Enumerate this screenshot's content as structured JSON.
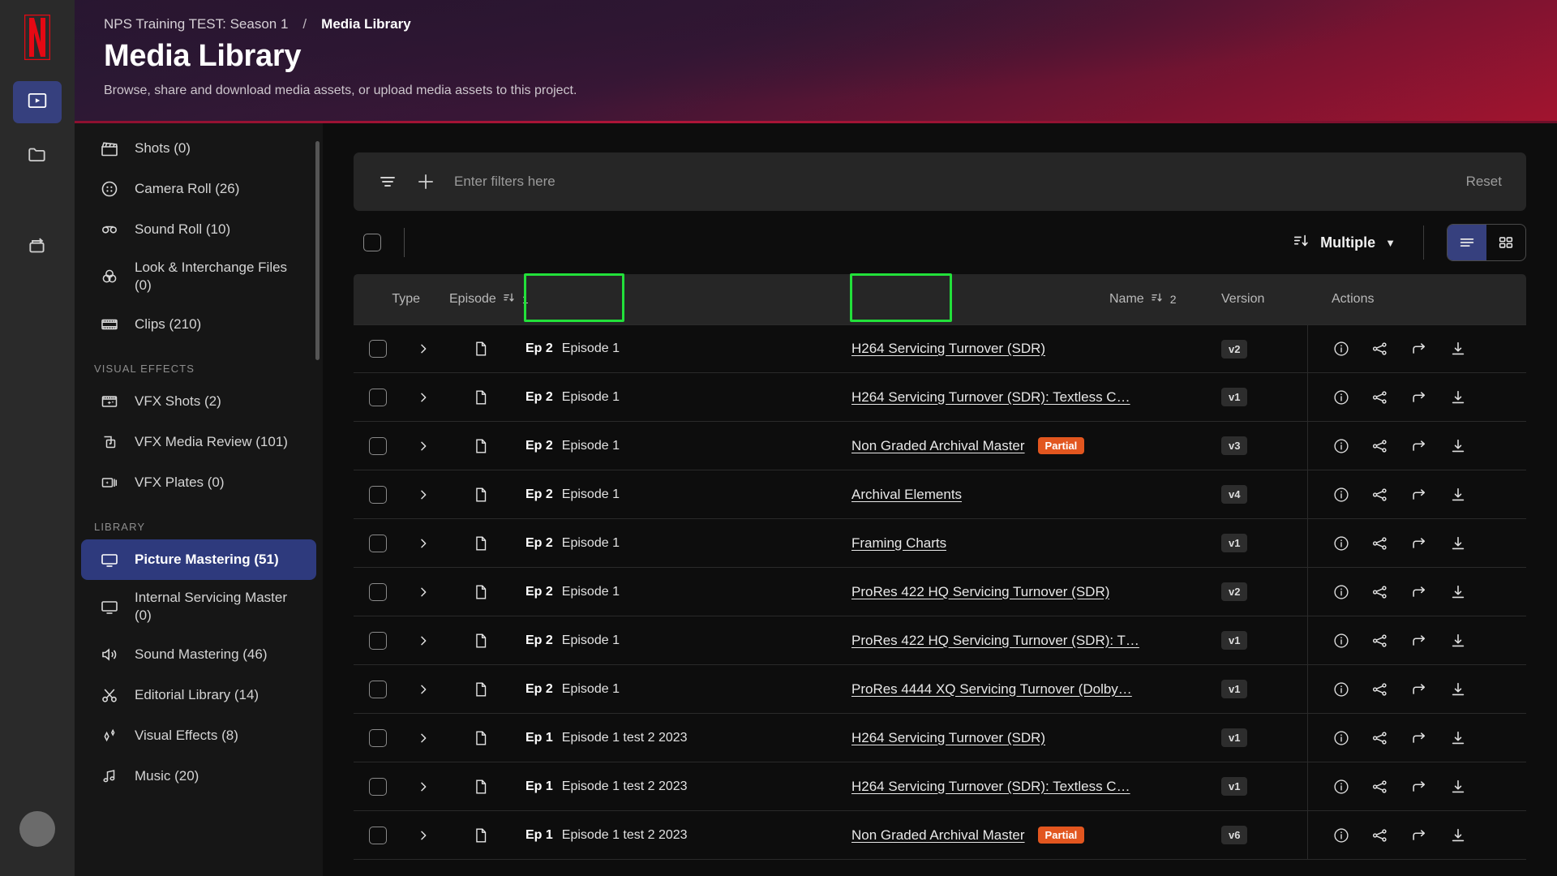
{
  "rail": {
    "logo": "netflix-n-logo",
    "buttons": [
      {
        "name": "media-player-icon",
        "active": true
      },
      {
        "name": "folder-icon",
        "active": false
      },
      {
        "name": "transfer-icon",
        "active": false
      }
    ],
    "avatar": "user-avatar"
  },
  "header": {
    "breadcrumb_project": "NPS Training TEST: Season 1",
    "breadcrumb_separator": "/",
    "breadcrumb_current": "Media Library",
    "title": "Media Library",
    "subtitle": "Browse, share and download media assets, or upload media assets to this project."
  },
  "sidebar": {
    "items": [
      {
        "label": "Shots (0)",
        "icon": "clapperboard-icon",
        "active": false
      },
      {
        "label": "Camera Roll (26)",
        "icon": "film-reel-icon",
        "active": false
      },
      {
        "label": "Sound Roll (10)",
        "icon": "sound-roll-icon",
        "active": false
      },
      {
        "label": "Look & Interchange Files (0)",
        "icon": "color-wheels-icon",
        "active": false
      },
      {
        "label": "Clips (210)",
        "icon": "filmstrip-icon",
        "active": false
      }
    ],
    "section_visual_effects": "VISUAL EFFECTS",
    "vfx_items": [
      {
        "label": "VFX Shots (2)",
        "icon": "vfx-shot-icon",
        "active": false
      },
      {
        "label": "VFX Media Review (101)",
        "icon": "vfx-review-icon",
        "active": false
      },
      {
        "label": "VFX Plates (0)",
        "icon": "vfx-plates-icon",
        "active": false
      }
    ],
    "section_library": "LIBRARY",
    "library_items": [
      {
        "label": "Picture Mastering (51)",
        "icon": "monitor-icon",
        "active": true
      },
      {
        "label": "Internal Servicing Master (0)",
        "icon": "monitor-icon",
        "active": false
      },
      {
        "label": "Sound Mastering (46)",
        "icon": "speaker-icon",
        "active": false
      },
      {
        "label": "Editorial Library (14)",
        "icon": "scissors-icon",
        "active": false
      },
      {
        "label": "Visual Effects (8)",
        "icon": "sparkle-icon",
        "active": false
      },
      {
        "label": "Music (20)",
        "icon": "music-note-icon",
        "active": false
      }
    ]
  },
  "filter_bar": {
    "filter_icon": "filter-icon",
    "add_icon": "plus-icon",
    "placeholder": "Enter filters here",
    "reset_label": "Reset"
  },
  "toolbar": {
    "select_all": "select-all-checkbox",
    "sort_label": "Multiple",
    "sort_icon": "sort-descending-icon",
    "caret_icon": "chevron-down-icon",
    "view_list": "list-view-icon",
    "view_grid": "grid-view-icon",
    "active_view": "list"
  },
  "table": {
    "columns": {
      "type": "Type",
      "episode": "Episode",
      "episode_sort_order": "1",
      "name": "Name",
      "name_sort_order": "2",
      "version": "Version",
      "actions": "Actions"
    },
    "action_icons": [
      "info-icon",
      "share-nodes-icon",
      "forward-arrow-icon",
      "download-icon"
    ],
    "rows": [
      {
        "episode_tag": "Ep 2",
        "episode_name": "Episode 1",
        "name": "H264 Servicing Turnover (SDR)",
        "badge": "",
        "version": "v2"
      },
      {
        "episode_tag": "Ep 2",
        "episode_name": "Episode 1",
        "name": "H264 Servicing Turnover (SDR): Textless C…",
        "badge": "",
        "version": "v1"
      },
      {
        "episode_tag": "Ep 2",
        "episode_name": "Episode 1",
        "name": "Non Graded Archival Master",
        "badge": "Partial",
        "version": "v3"
      },
      {
        "episode_tag": "Ep 2",
        "episode_name": "Episode 1",
        "name": "Archival Elements",
        "badge": "",
        "version": "v4"
      },
      {
        "episode_tag": "Ep 2",
        "episode_name": "Episode 1",
        "name": "Framing Charts",
        "badge": "",
        "version": "v1"
      },
      {
        "episode_tag": "Ep 2",
        "episode_name": "Episode 1",
        "name": "ProRes 422 HQ Servicing Turnover (SDR)",
        "badge": "",
        "version": "v2"
      },
      {
        "episode_tag": "Ep 2",
        "episode_name": "Episode 1",
        "name": "ProRes 422 HQ Servicing Turnover (SDR): T…",
        "badge": "",
        "version": "v1"
      },
      {
        "episode_tag": "Ep 2",
        "episode_name": "Episode 1",
        "name": "ProRes 4444 XQ Servicing Turnover (Dolby…",
        "badge": "",
        "version": "v1"
      },
      {
        "episode_tag": "Ep 1",
        "episode_name": "Episode 1 test 2 2023",
        "name": "H264 Servicing Turnover (SDR)",
        "badge": "",
        "version": "v1"
      },
      {
        "episode_tag": "Ep 1",
        "episode_name": "Episode 1 test 2 2023",
        "name": "H264 Servicing Turnover (SDR): Textless C…",
        "badge": "",
        "version": "v1"
      },
      {
        "episode_tag": "Ep 1",
        "episode_name": "Episode 1 test 2 2023",
        "name": "Non Graded Archival Master",
        "badge": "Partial",
        "version": "v6"
      }
    ]
  },
  "colors": {
    "accent_blue": "#36407e",
    "netflix_red": "#e50914",
    "badge_orange": "#e2561f",
    "highlight_green": "#22e03a"
  }
}
